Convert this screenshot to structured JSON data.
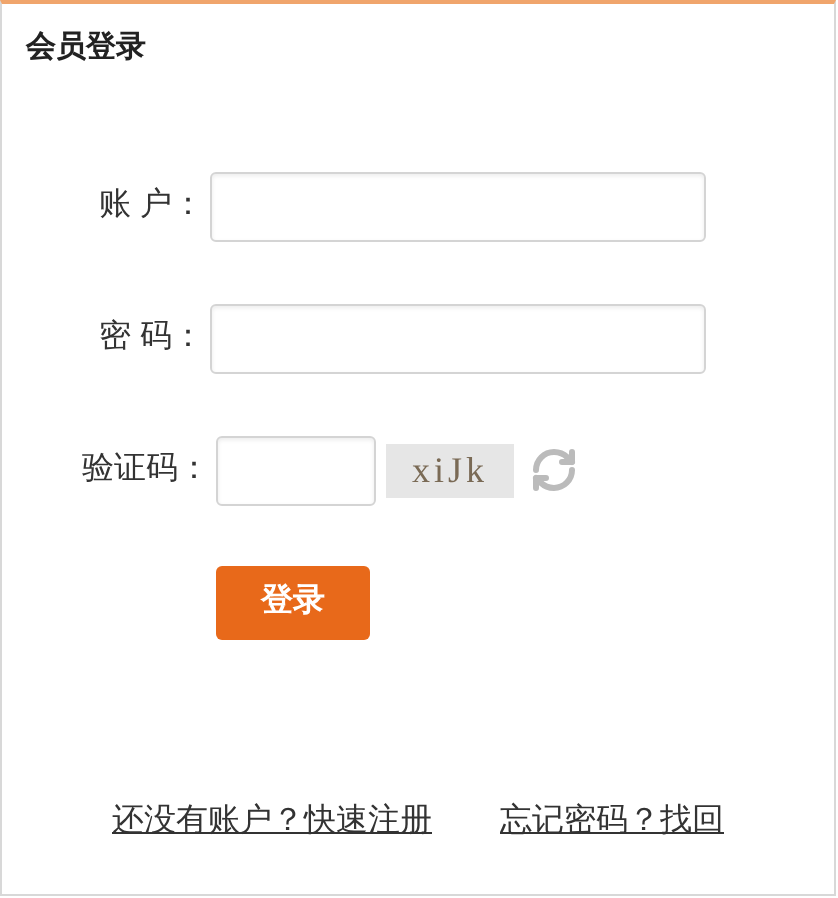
{
  "title": "会员登录",
  "fields": [
    {
      "label": "账 户："
    },
    {
      "label": "密 码："
    }
  ],
  "captcha": {
    "label": "验证码：",
    "code": "xiJk"
  },
  "submit": "登录",
  "links": [
    "还没有账户？快速注册",
    "忘记密码？找回"
  ]
}
